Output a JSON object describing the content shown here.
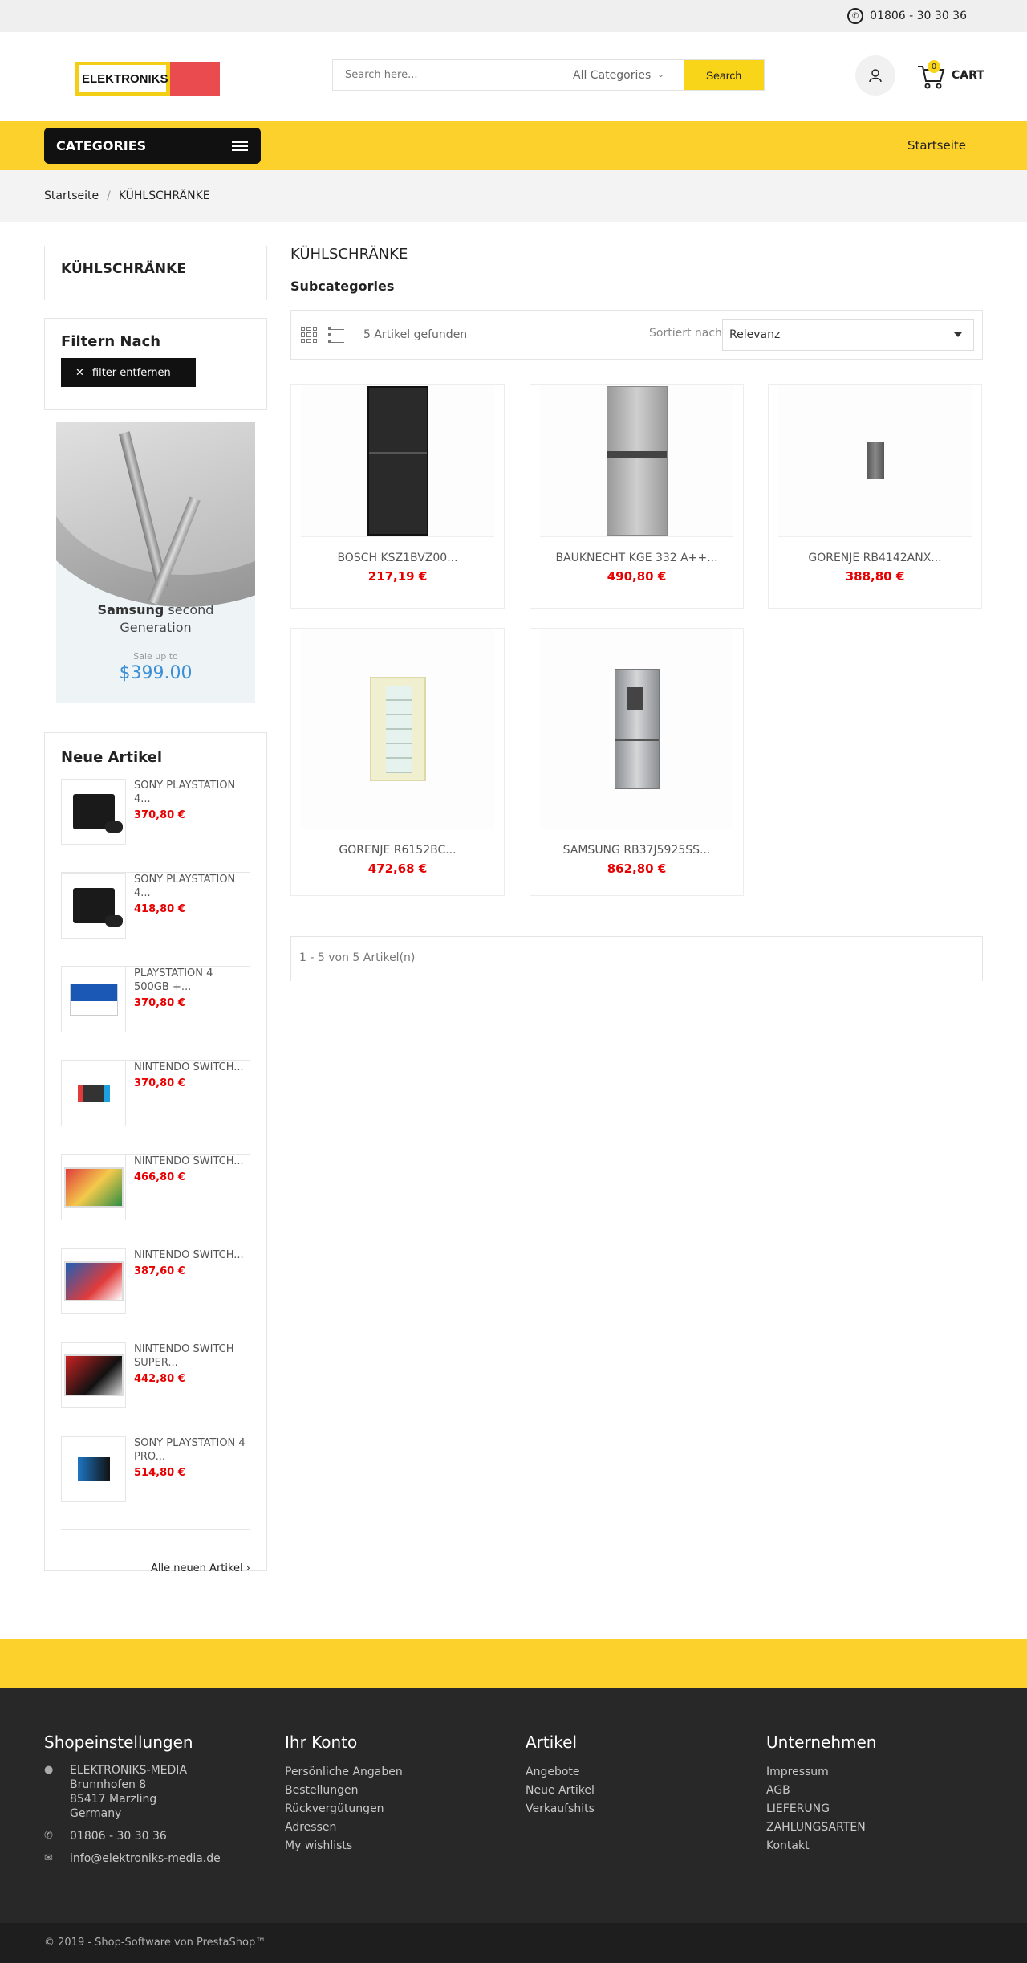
{
  "topbar": {
    "phone": "01806 - 30 30 36"
  },
  "header": {
    "logo_text": "ELEKTRONIKS",
    "search_placeholder": "Search here...",
    "category_select": "All Categories",
    "search_button": "Search",
    "cart_count": "0",
    "cart_label": "CART"
  },
  "nav": {
    "categories_label": "CATEGORIES",
    "home_link": "Startseite"
  },
  "breadcrumb": {
    "home": "Startseite",
    "separator": "/",
    "current": "KÜHLSCHRÄNKE"
  },
  "sidebar": {
    "category_title": "KÜHLSCHRÄNKE",
    "filter_title": "Filtern Nach",
    "filter_remove": "filter entfernen",
    "banner": {
      "brand": "Samsung",
      "line1": "second",
      "line2": "Generation",
      "sale": "Sale up to",
      "price": "$399.00"
    },
    "new_title": "Neue Artikel",
    "new_items": [
      {
        "name": "SONY PLAYSTATION 4...",
        "price": "370,80 €",
        "thumb": "ps4-icon"
      },
      {
        "name": "SONY PLAYSTATION 4...",
        "price": "418,80 €",
        "thumb": "ps4-icon"
      },
      {
        "name": "PLAYSTATION 4 500GB +...",
        "price": "370,80 €",
        "thumb": "ps4-box-icon"
      },
      {
        "name": "NINTENDO SWITCH...",
        "price": "370,80 €",
        "thumb": "switch-icon"
      },
      {
        "name": "NINTENDO SWITCH...",
        "price": "466,80 €",
        "thumb": "switch-box-icon"
      },
      {
        "name": "NINTENDO SWITCH...",
        "price": "387,60 €",
        "thumb": "switch-box-icon"
      },
      {
        "name": "NINTENDO SWITCH SUPER...",
        "price": "442,80 €",
        "thumb": "switch-box-icon"
      },
      {
        "name": "SONY PLAYSTATION 4 PRO...",
        "price": "514,80 €",
        "thumb": "ps4-pro-icon"
      }
    ],
    "all_new_link": "Alle neuen Artikel ›"
  },
  "main": {
    "title": "KÜHLSCHRÄNKE",
    "subcategories": "Subcategories",
    "found": "5 Artikel gefunden",
    "sort_label": "Sortiert nach:",
    "sort_value": "Relevanz",
    "products": [
      {
        "name": "BOSCH KSZ1BVZ00...",
        "price": "217,19 €"
      },
      {
        "name": "BAUKNECHT KGE 332 A++...",
        "price": "490,80 €"
      },
      {
        "name": "GORENJE RB4142ANX...",
        "price": "388,80 €"
      },
      {
        "name": "GORENJE R6152BC...",
        "price": "472,68 €"
      },
      {
        "name": "SAMSUNG RB37J5925SS...",
        "price": "862,80 €"
      }
    ],
    "pagination": "1 - 5 von 5 Artikel(n)"
  },
  "footer": {
    "col1": {
      "title": "Shopeinstellungen",
      "company": "ELEKTRONIKS-MEDIA",
      "street": "Brunnhofen 8",
      "city": "85417 Marzling",
      "country": "Germany",
      "phone": "01806 - 30 30 36",
      "email": "info@elektroniks-media.de"
    },
    "col2": {
      "title": "Ihr Konto",
      "links": [
        "Persönliche Angaben",
        "Bestellungen",
        "Rückvergütungen",
        "Adressen",
        "My wishlists"
      ]
    },
    "col3": {
      "title": "Artikel",
      "links": [
        "Angebote",
        "Neue Artikel",
        "Verkaufshits"
      ]
    },
    "col4": {
      "title": "Unternehmen",
      "links": [
        "Impressum",
        "AGB",
        "LIEFERUNG",
        "ZAHLUNGSARTEN",
        "Kontakt"
      ]
    },
    "copyright": "© 2019 - Shop-Software von PrestaShop™"
  },
  "colors": {
    "accent_yellow": "#fdd12b",
    "price_red": "#e60000",
    "footer_dark": "#282828"
  }
}
